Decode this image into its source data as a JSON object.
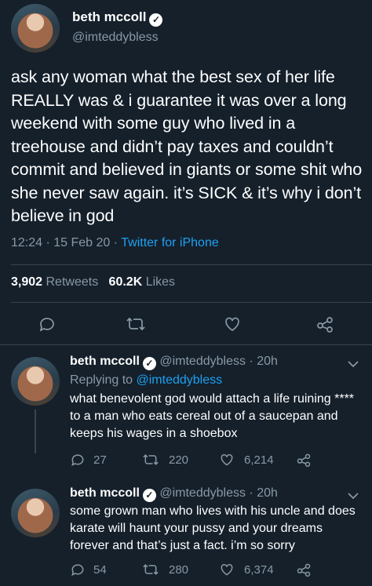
{
  "main": {
    "name": "beth mccoll",
    "handle": "@imteddybless",
    "text": "ask any woman what the best sex of her life REALLY was & i guarantee it was over a long weekend with some guy who lived in a treehouse and didn’t pay taxes and couldn’t commit and believed in giants or some shit who she never saw again. it’s SICK & it’s why i don’t believe in god",
    "time": "12:24 · 15 Feb 20 · ",
    "source": "Twitter for iPhone",
    "retweets_count": "3,902",
    "retweets_label": "Retweets",
    "likes_count": "60.2K",
    "likes_label": "Likes"
  },
  "replies": [
    {
      "name": "beth mccoll",
      "meta": "@imteddybless · 20h",
      "replying_prefix": "Replying to ",
      "replying_to": "@imteddybless",
      "text": "what benevolent god would attach a life ruining **** to a man who eats cereal out of a saucepan and keeps his wages in a shoebox",
      "comments": "27",
      "retweets": "220",
      "likes": "6,214"
    },
    {
      "name": "beth mccoll",
      "meta": "@imteddybless · 20h",
      "text": "some grown man who lives with his uncle and does karate will haunt your pussy and your dreams forever and that’s just a fact. i’m so sorry",
      "comments": "54",
      "retweets": "280",
      "likes": "6,374"
    }
  ],
  "colors": {
    "background": "#15202b",
    "accent": "#1da1f2",
    "muted": "#8899a6",
    "divider": "#38444d"
  },
  "icons": [
    "verified-icon",
    "reply-icon",
    "retweet-icon",
    "like-icon",
    "share-icon",
    "chevron-down-icon"
  ]
}
